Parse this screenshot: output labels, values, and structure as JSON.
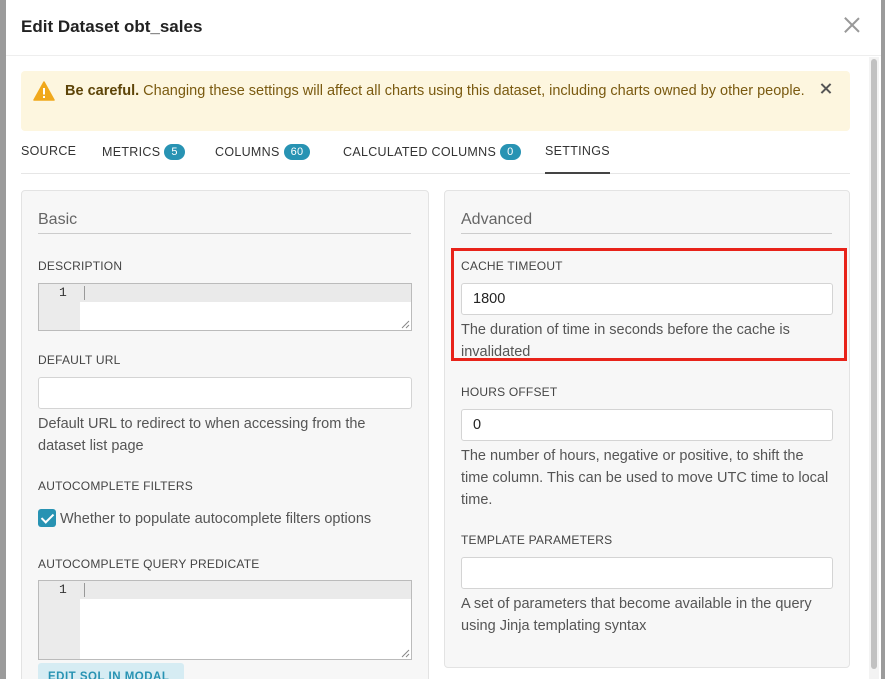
{
  "modal": {
    "title": "Edit Dataset obt_sales"
  },
  "alert": {
    "strong": "Be careful.",
    "message": " Changing these settings will affect all charts using this dataset, including charts owned by other people."
  },
  "tabs": [
    {
      "label": "SOURCE"
    },
    {
      "label": "METRICS",
      "badge": "5"
    },
    {
      "label": "COLUMNS",
      "badge": "60"
    },
    {
      "label": "CALCULATED COLUMNS",
      "badge": "0"
    },
    {
      "label": "SETTINGS",
      "active": true
    }
  ],
  "basic": {
    "title": "Basic",
    "description_label": "DESCRIPTION",
    "description_line_number": "1",
    "default_url_label": "DEFAULT URL",
    "default_url_value": "",
    "default_url_help": "Default URL to redirect to when accessing from the dataset list page",
    "autocomplete_filters_label": "AUTOCOMPLETE FILTERS",
    "autocomplete_checkbox_label": "Whether to populate autocomplete filters options",
    "autocomplete_checked": true,
    "predicate_label": "AUTOCOMPLETE QUERY PREDICATE",
    "predicate_line_number": "1",
    "edit_sql_button": "EDIT  SQL  IN MODAL"
  },
  "advanced": {
    "title": "Advanced",
    "cache_timeout_label": "CACHE TIMEOUT",
    "cache_timeout_value": "1800",
    "cache_timeout_help": "The duration of time in seconds before the cache is invalidated",
    "hours_offset_label": "HOURS OFFSET",
    "hours_offset_value": "0",
    "hours_offset_help": "The number of hours, negative or positive, to shift the time column. This can be used to move UTC time to local time.",
    "template_params_label": "TEMPLATE PARAMETERS",
    "template_params_value": "",
    "template_params_help": "A set of parameters that become available in the query using Jinja templating syntax"
  },
  "colors": {
    "accent": "#2893b3",
    "warning_bg": "#fdf6df",
    "warning_icon": "#f0a81c",
    "highlight": "#e8231a"
  }
}
